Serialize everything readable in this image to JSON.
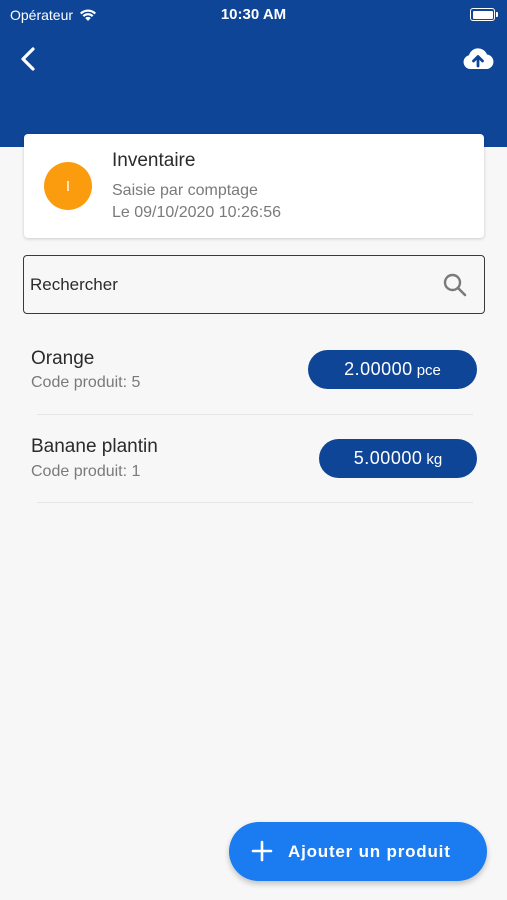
{
  "status_bar": {
    "carrier": "Opérateur",
    "time": "10:30 AM"
  },
  "header": {
    "back_icon": "chevron-left-icon",
    "upload_icon": "cloud-upload-icon",
    "background": "#0e4597"
  },
  "inventory_card": {
    "avatar_letter": "I",
    "avatar_color": "#fb9b0e",
    "title": "Inventaire",
    "subtitle": "Saisie par comptage",
    "date": "Le 09/10/2020 10:26:56"
  },
  "search": {
    "placeholder": "Rechercher",
    "icon": "search-icon"
  },
  "products": [
    {
      "name": "Orange",
      "code": "Code produit: 5",
      "quantity": "2.00000",
      "unit": "pce"
    },
    {
      "name": "Banane plantin",
      "code": "Code produit: 1",
      "quantity": "5.00000",
      "unit": "kg"
    }
  ],
  "fab": {
    "label": "Ajouter un produit",
    "icon": "plus-icon",
    "color": "#1b7cf2"
  }
}
